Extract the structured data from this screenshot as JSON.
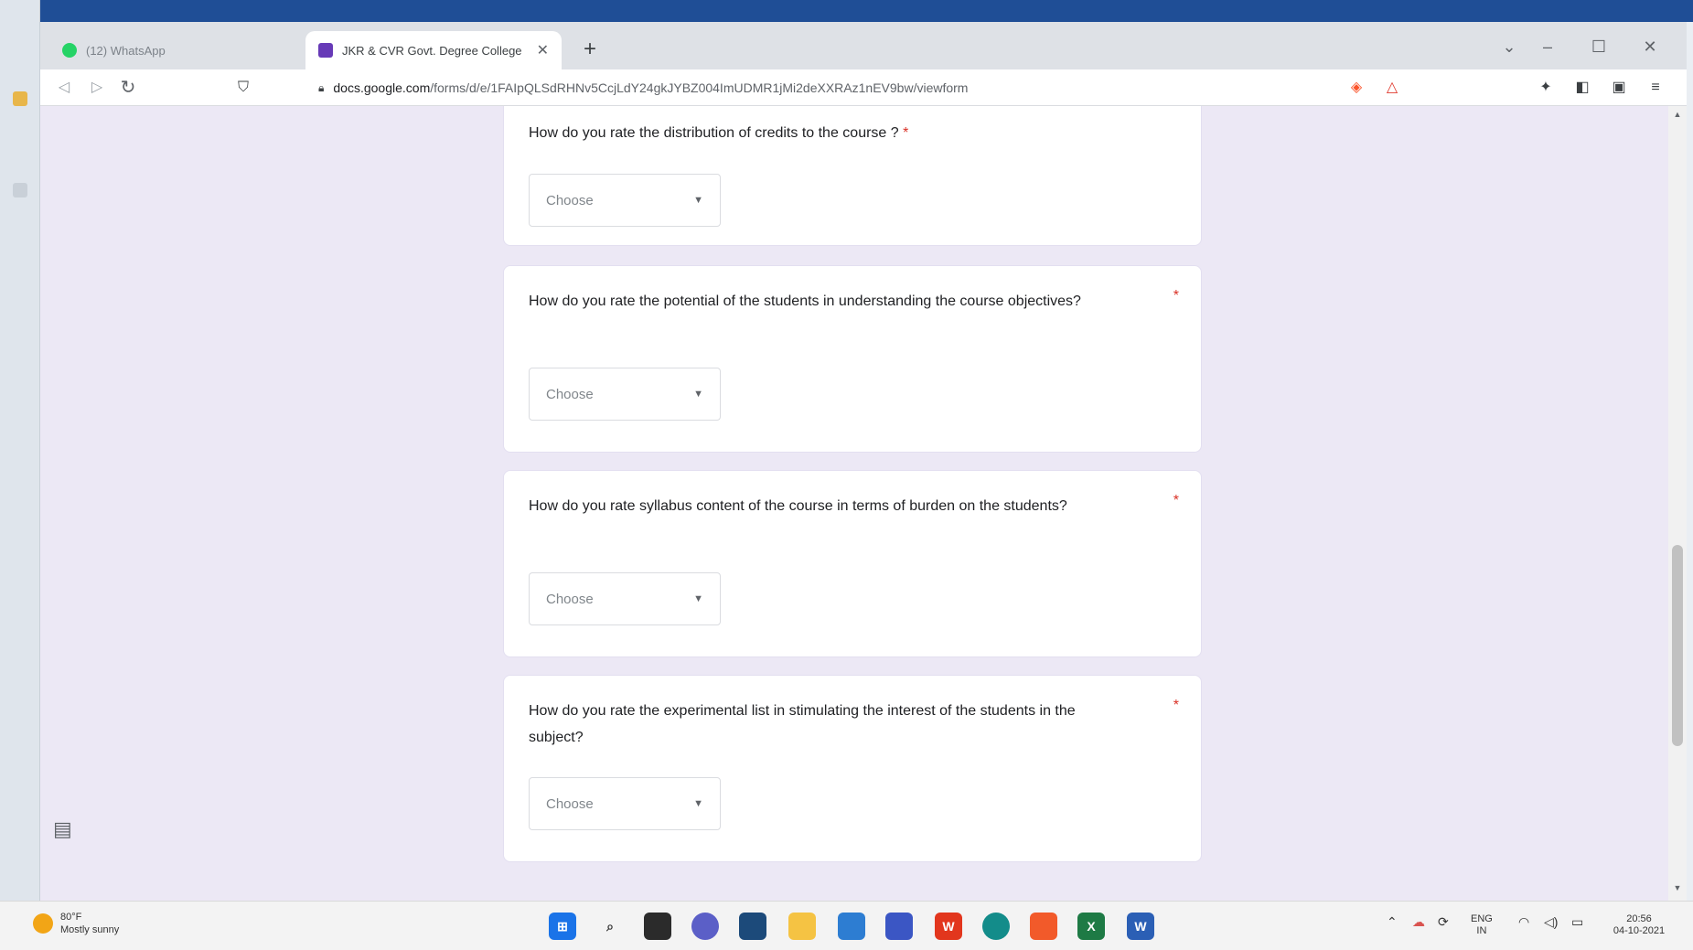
{
  "browser": {
    "tabs": [
      {
        "title": "(12) WhatsApp",
        "active": false,
        "icon": "whatsapp-icon"
      },
      {
        "title": "JKR & CVR Govt. Degree College",
        "active": true,
        "icon": "google-forms-icon"
      }
    ],
    "new_tab_symbol": "+",
    "url": {
      "host": "docs.google.com",
      "path": "/forms/d/e/1FAIpQLSdRHNv5CcjLdY24gkJYBZ004ImUDMR1jMi2deXXRAz1nEV9bw/viewform"
    },
    "window_controls": {
      "minimize": "–",
      "maximize": "☐",
      "close": "✕",
      "tab_search": "⌄"
    }
  },
  "form": {
    "questions": [
      {
        "text": "How do you rate the distribution of credits to the course ?",
        "required_mark": "*",
        "dropdown": "Choose"
      },
      {
        "text": "How do you rate the potential of the students in understanding the course objectives?",
        "required_mark": "*",
        "dropdown": "Choose"
      },
      {
        "text": "How do you rate syllabus content of the course in terms of burden on the students?",
        "required_mark": "*",
        "dropdown": "Choose"
      },
      {
        "text": "How do you rate the experimental list in stimulating the interest of the students in the subject?",
        "required_mark": "*",
        "dropdown": "Choose"
      }
    ]
  },
  "taskbar": {
    "weather": {
      "temp": "80°F",
      "condition": "Mostly sunny"
    },
    "apps": [
      "windows-start-icon",
      "search-icon",
      "file-explorer-icon",
      "chat-icon",
      "app-icon",
      "folder-icon",
      "mail-icon",
      "visual-studio-icon",
      "wps-office-icon",
      "edge-icon",
      "brave-icon",
      "excel-icon",
      "word-icon"
    ],
    "language": {
      "top": "ENG",
      "bottom": "IN"
    },
    "clock": {
      "time": "20:56",
      "date": "04-10-2021"
    }
  },
  "colors": {
    "page_background": "#ece8f5",
    "forms_accent": "#673ab7",
    "required": "#d93025",
    "taskbar": "#f3f3f3"
  }
}
